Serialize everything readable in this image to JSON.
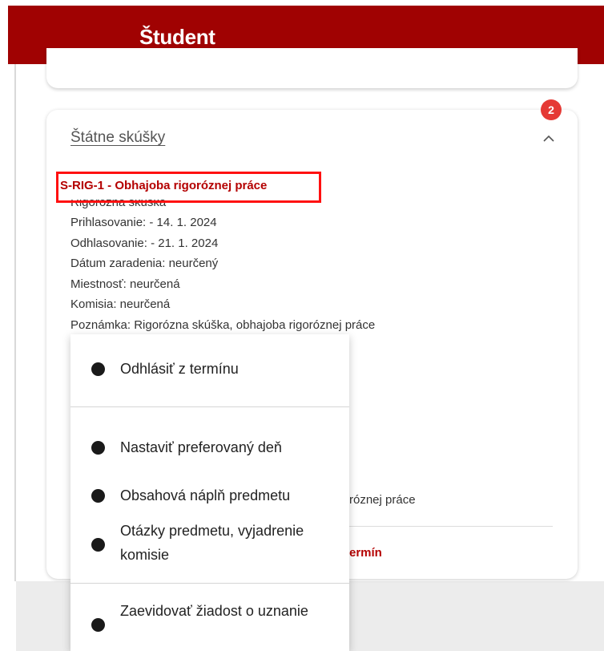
{
  "header": {
    "title": "Študent",
    "brand_color": "#a00202"
  },
  "section": {
    "title": "Štátne skúšky",
    "badge_count": "2",
    "toggle_icon": "chevron-up-icon"
  },
  "exam": {
    "code_title": "S-RIG-1 - Obhajoba rigoróznej práce",
    "type": "Rigorózna skúška",
    "registration": "Prihlasovanie: - 14. 1. 2024",
    "deregistration": "Odhlasovanie: - 21. 1. 2024",
    "assignment_date": "Dátum zaradenia: neurčený",
    "room": "Miestnosť: neurčená",
    "committee": "Komisia: neurčená",
    "note": "Poznámka: Rigorózna skúška, obhajoba rigoróznej práce",
    "note_fragment_behind": "róznej práce",
    "action_fragment_behind": "ermín"
  },
  "menu": {
    "items": [
      {
        "label": "Odhlásiť z termínu"
      },
      {
        "label": "Nastaviť preferovaný deň"
      },
      {
        "label": "Obsahová náplň predmetu"
      },
      {
        "label": "Otázky predmetu, vyjadrenie komisie"
      },
      {
        "label": "Zaevidovať žiadost o uznanie"
      }
    ]
  }
}
